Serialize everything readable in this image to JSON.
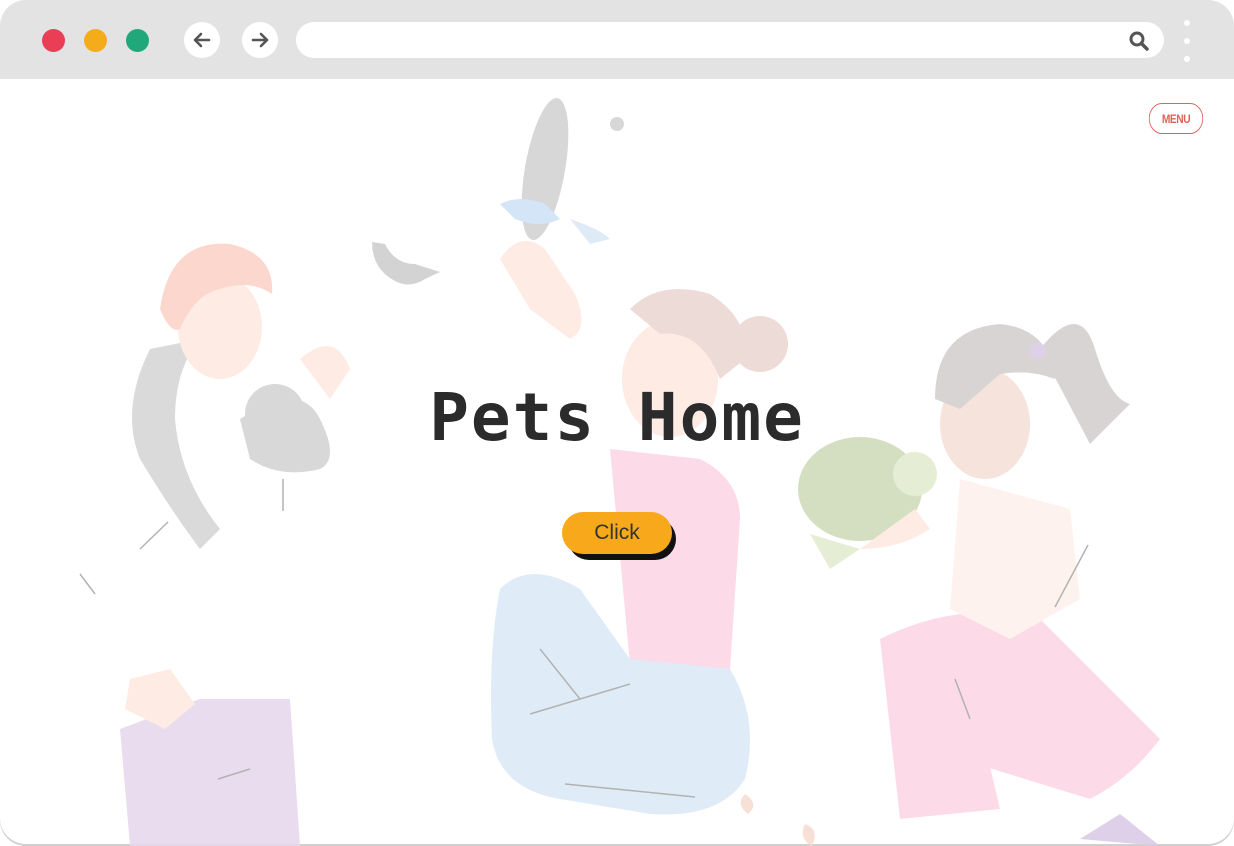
{
  "browser": {
    "controls": [
      "close",
      "minimize",
      "maximize"
    ],
    "back_icon": "arrow-left-icon",
    "forward_icon": "arrow-right-icon",
    "address_value": "",
    "search_icon": "search-icon",
    "menu_icon": "kebab-menu-icon"
  },
  "page": {
    "menu_label": "MENU",
    "title": "Pets Home",
    "cta_label": "Click"
  },
  "colors": {
    "titlebar": "#e3e3e3",
    "close": "#ea3d56",
    "minimize": "#f4ac1b",
    "maximize": "#20a87a",
    "menu_accent": "#e0625a",
    "cta": "#f7a91b",
    "title_text": "#2b2b2b"
  }
}
